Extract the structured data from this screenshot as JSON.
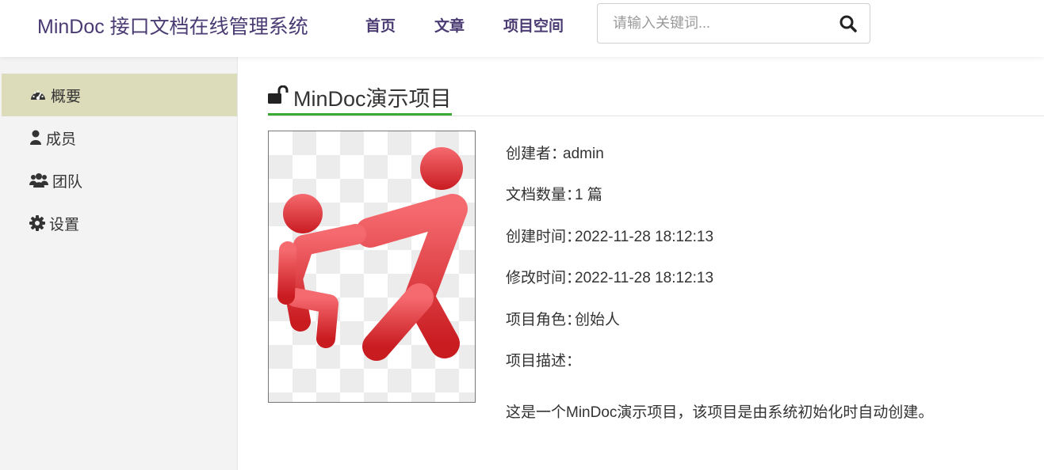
{
  "header": {
    "brand": "MinDoc 接口文档在线管理系统",
    "nav": [
      "首页",
      "文章",
      "项目空间"
    ],
    "search_placeholder": "请输入关键词..."
  },
  "sidebar": {
    "items": [
      {
        "label": "概要",
        "icon": "dashboard-icon",
        "active": true
      },
      {
        "label": "成员",
        "icon": "user-icon",
        "active": false
      },
      {
        "label": "团队",
        "icon": "users-icon",
        "active": false
      },
      {
        "label": "设置",
        "icon": "gear-icon",
        "active": false
      }
    ]
  },
  "project": {
    "title": "MinDoc演示项目",
    "icon": "unlock-icon",
    "info": [
      {
        "label": "创建者：",
        "value": "admin"
      },
      {
        "label": "文档数量：",
        "value": "1 篇"
      },
      {
        "label": "创建时间：",
        "value": "2022-11-28 18:12:13"
      },
      {
        "label": "修改时间：",
        "value": "2022-11-28 18:12:13"
      },
      {
        "label": "项目角色：",
        "value": "创始人"
      },
      {
        "label": "项目描述：",
        "value": ""
      }
    ],
    "description": "这是一个MinDoc演示项目，该项目是由系统初始化时自动创建。"
  },
  "colors": {
    "brand": "#4a3b73",
    "active_sidebar": "#dcdcba",
    "title_underline": "#3aaa35",
    "cover_red": "#e03b3e"
  }
}
